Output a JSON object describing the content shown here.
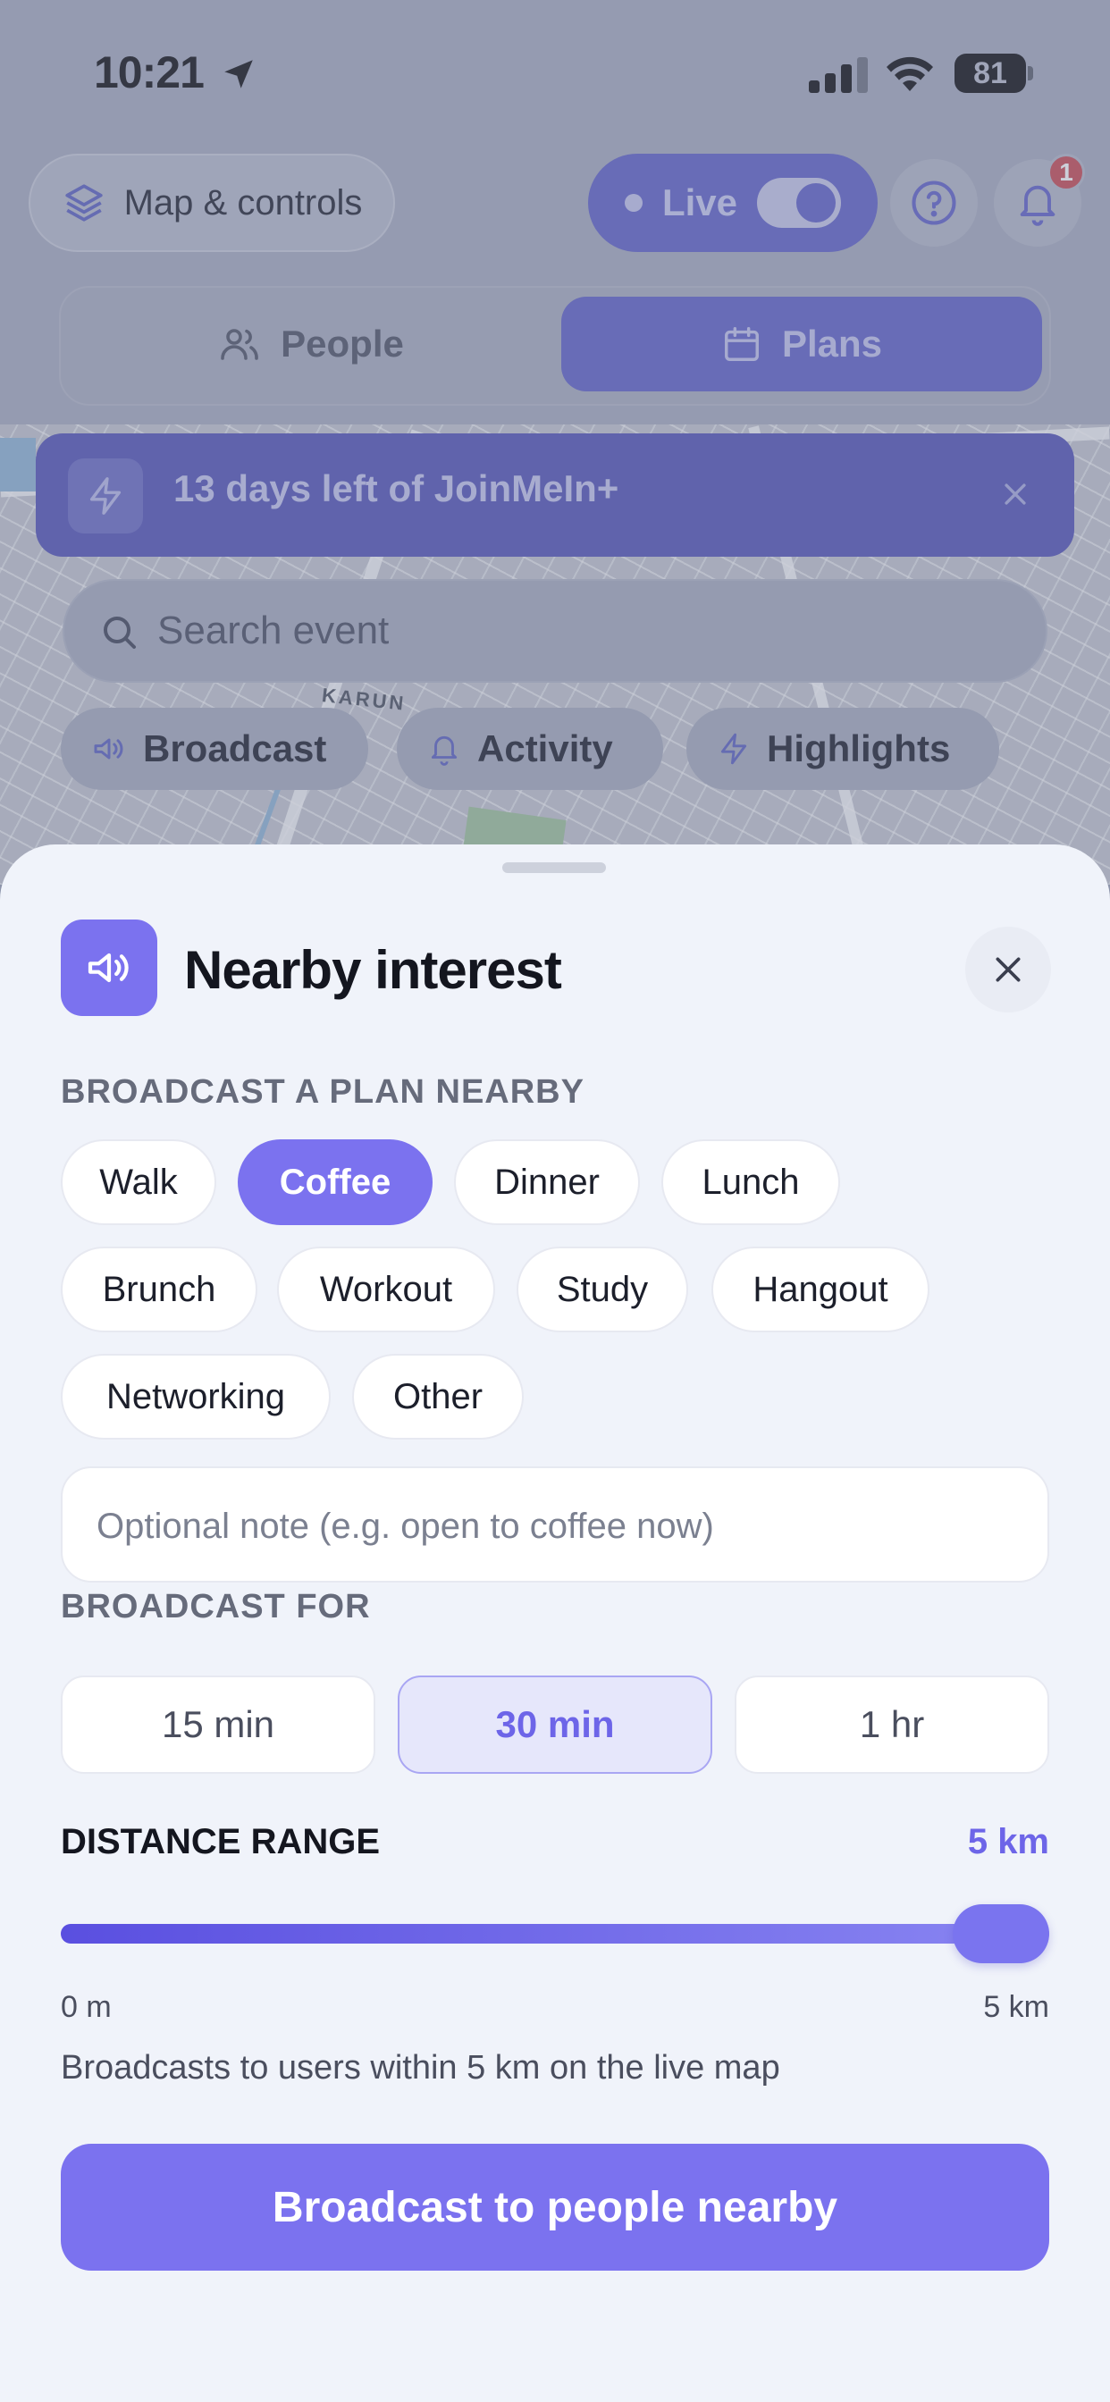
{
  "status_bar": {
    "time": "10:21",
    "battery": "81"
  },
  "top": {
    "map_controls_label": "Map & controls",
    "live_label": "Live",
    "notification_count": "1"
  },
  "segments": {
    "people": "People",
    "plans": "Plans",
    "selected": "Plans"
  },
  "promo": {
    "text": "13 days left of JoinMeIn+"
  },
  "search": {
    "placeholder": "Search event",
    "value": ""
  },
  "map": {
    "label": "KARUN"
  },
  "quick_chips": {
    "broadcast": "Broadcast",
    "activity": "Activity",
    "highlights": "Highlights"
  },
  "sheet": {
    "title": "Nearby interest",
    "broadcast_section": "BROADCAST A PLAN NEARBY",
    "plans": [
      "Walk",
      "Coffee",
      "Dinner",
      "Lunch",
      "Brunch",
      "Workout",
      "Study",
      "Hangout",
      "Networking",
      "Other"
    ],
    "selected_plan": "Coffee",
    "note_placeholder": "Optional note (e.g. open to coffee now)",
    "note_value": "",
    "broadcast_for_section": "BROADCAST FOR",
    "durations": [
      "15 min",
      "30 min",
      "1 hr"
    ],
    "selected_duration": "30 min",
    "distance_label": "DISTANCE RANGE",
    "distance_value": "5 km",
    "distance_fraction": 1.0,
    "range_min": "0 m",
    "range_max": "5 km",
    "distance_hint": "Broadcasts to users within 5 km on the live map",
    "cta": "Broadcast to people nearby"
  },
  "colors": {
    "accent": "#7b72ef",
    "live_accent": "#5e5fc8",
    "badge": "#c9474f"
  }
}
